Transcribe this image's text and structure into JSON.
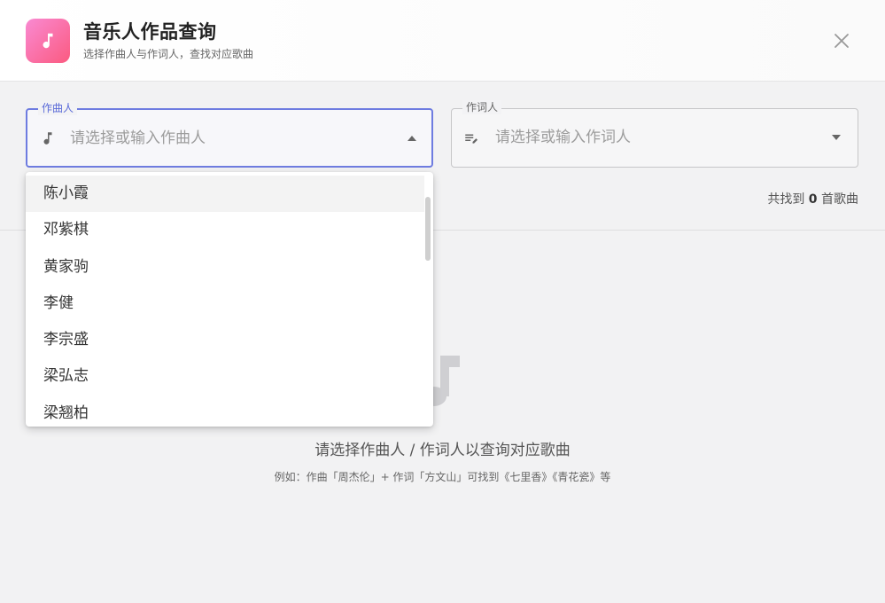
{
  "header": {
    "title": "音乐人作品查询",
    "subtitle": "选择作曲人与作词人，查找对应歌曲",
    "icon": "music-note-icon",
    "icon_gradient": [
      "#f98ad2",
      "#fb5a80"
    ]
  },
  "composer_field": {
    "label": "作曲人",
    "placeholder": "请选择或输入作曲人",
    "value": "",
    "icon": "music-note-icon",
    "accent": "#5b6bd8",
    "open": true
  },
  "lyricist_field": {
    "label": "作词人",
    "placeholder": "请选择或输入作词人",
    "value": "",
    "icon": "lyrics-edit-icon"
  },
  "result": {
    "prefix": "共找到",
    "count": "0",
    "suffix": "首歌曲"
  },
  "empty_state": {
    "message": "请选择作曲人 / 作词人以查询对应歌曲",
    "hint": "例如：作曲「周杰伦」+ 作词「方文山」可找到《七里香》《青花瓷》等"
  },
  "composer_options": [
    "陈小霞",
    "邓紫棋",
    "黄家驹",
    "李健",
    "李宗盛",
    "梁弘志",
    "梁翘柏"
  ]
}
